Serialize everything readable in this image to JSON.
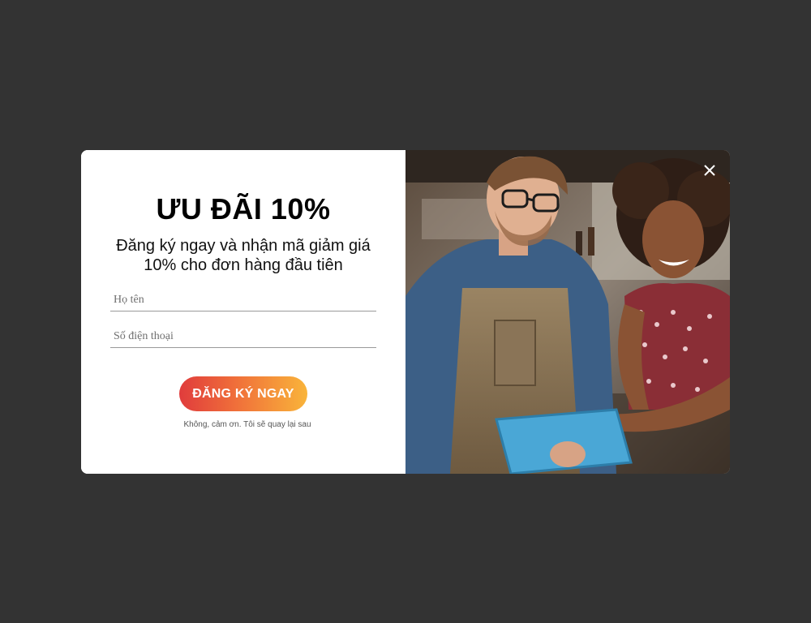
{
  "popup": {
    "title": "ƯU ĐÃI 10%",
    "subtitle": "Đăng ký ngay và nhận mã giảm giá 10% cho đơn hàng đầu tiên",
    "fields": {
      "name_placeholder": "Họ tên",
      "name_value": "",
      "phone_placeholder": "Số điện thoại",
      "phone_value": ""
    },
    "submit_label": "ĐĂNG KÝ NGAY",
    "decline_label": "Không, cảm ơn. Tôi sẽ quay lại sau",
    "close_icon": "close-icon",
    "colors": {
      "backdrop": "#333333",
      "gradient_start": "#e03c3c",
      "gradient_end": "#f9b43a"
    }
  }
}
